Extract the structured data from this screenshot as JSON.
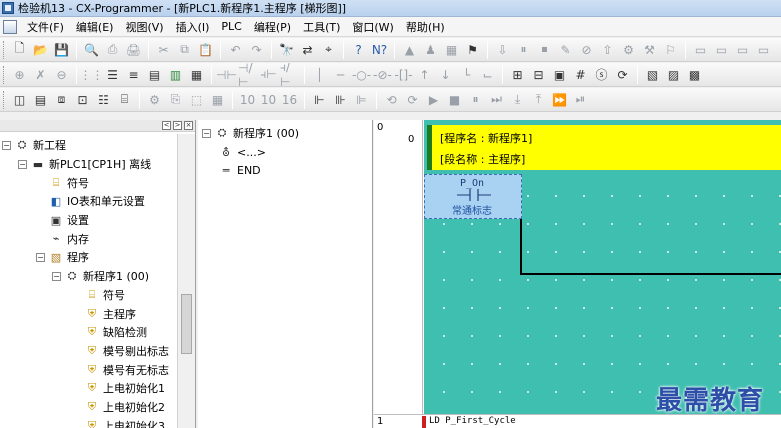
{
  "window": {
    "title": "检验机13 - CX-Programmer - [新PLC1.新程序1.主程序 [梯形图]]"
  },
  "menu": [
    "文件(F)",
    "编辑(E)",
    "视图(V)",
    "插入(I)",
    "PLC",
    "编程(P)",
    "工具(T)",
    "窗口(W)",
    "帮助(H)"
  ],
  "toolbar1": [
    {
      "icon": "new-icon",
      "glyph": "🗋",
      "tone": ""
    },
    {
      "icon": "open-icon",
      "glyph": "📂",
      "tone": ""
    },
    {
      "icon": "save-icon",
      "glyph": "💾",
      "tone": ""
    },
    {
      "icon": "print-preview-icon",
      "glyph": "🔍",
      "tone": ""
    },
    {
      "icon": "print-icon",
      "glyph": "⎙",
      "tone": "dim"
    },
    {
      "icon": "print-setup-icon",
      "glyph": "🖨",
      "tone": "dim"
    },
    {
      "icon": "cut-icon",
      "glyph": "✂",
      "tone": "dim"
    },
    {
      "icon": "copy-icon",
      "glyph": "⧉",
      "tone": "dim"
    },
    {
      "icon": "paste-icon",
      "glyph": "📋",
      "tone": "dim"
    },
    {
      "icon": "undo-icon",
      "glyph": "↶",
      "tone": "dim"
    },
    {
      "icon": "redo-icon",
      "glyph": "↷",
      "tone": "dim"
    },
    {
      "icon": "find-icon",
      "glyph": "🔭",
      "tone": ""
    },
    {
      "icon": "replace-icon",
      "glyph": "⇄",
      "tone": ""
    },
    {
      "icon": "find-address-icon",
      "glyph": "⌖",
      "tone": ""
    },
    {
      "icon": "help-icon",
      "glyph": "?",
      "tone": "blue"
    },
    {
      "icon": "context-help-icon",
      "glyph": "N?",
      "tone": "blue"
    },
    {
      "icon": "online-icon",
      "glyph": "▲",
      "tone": "dim"
    },
    {
      "icon": "monitor-icon",
      "glyph": "♟",
      "tone": "dim"
    },
    {
      "icon": "monitor-data-icon",
      "glyph": "▦",
      "tone": "dim"
    },
    {
      "icon": "compare-icon",
      "glyph": "⚑",
      "tone": ""
    },
    {
      "icon": "transfer-icon",
      "glyph": "⇩",
      "tone": "dim"
    },
    {
      "icon": "pause-icon",
      "glyph": "⏸",
      "tone": "dim"
    },
    {
      "icon": "stop-icon",
      "glyph": "⏹",
      "tone": "dim"
    },
    {
      "icon": "edit-online-icon",
      "glyph": "✎",
      "tone": "dim"
    },
    {
      "icon": "cancel-online-icon",
      "glyph": "⊘",
      "tone": "dim"
    },
    {
      "icon": "transfer-online-icon",
      "glyph": "⇧",
      "tone": "dim"
    },
    {
      "icon": "program-mode-icon",
      "glyph": "⚙",
      "tone": "dim"
    },
    {
      "icon": "debug-mode-icon",
      "glyph": "⚒",
      "tone": "dim"
    },
    {
      "icon": "run-mode-icon",
      "glyph": "⚐",
      "tone": "dim"
    },
    {
      "icon": "window1-icon",
      "glyph": "▭",
      "tone": "dim"
    },
    {
      "icon": "window2-icon",
      "glyph": "▭",
      "tone": "dim"
    },
    {
      "icon": "window3-icon",
      "glyph": "▭",
      "tone": "dim"
    },
    {
      "icon": "window4-icon",
      "glyph": "▭",
      "tone": "dim"
    }
  ],
  "toolbar2": [
    {
      "icon": "zoom-in-icon",
      "glyph": "⊕",
      "tone": "dim"
    },
    {
      "icon": "selection-tool-icon",
      "glyph": "✗",
      "tone": "dim"
    },
    {
      "icon": "zoom-out-icon",
      "glyph": "⊖",
      "tone": "dim"
    },
    {
      "icon": "grid-icon",
      "glyph": "⋮⋮",
      "tone": "dim"
    },
    {
      "icon": "comment-icon",
      "glyph": "☰",
      "tone": ""
    },
    {
      "icon": "list-icon",
      "glyph": "≡",
      "tone": ""
    },
    {
      "icon": "rung-comment-icon",
      "glyph": "▤",
      "tone": ""
    },
    {
      "icon": "bar-icon",
      "glyph": "▥",
      "tone": "green"
    },
    {
      "icon": "monitor-comment-icon",
      "glyph": "▦",
      "tone": ""
    },
    {
      "icon": "contact-no-icon",
      "glyph": "⊣⊢",
      "tone": "dim"
    },
    {
      "icon": "contact-nc-icon",
      "glyph": "⊣/⊢",
      "tone": "dim"
    },
    {
      "icon": "contact-or-icon",
      "glyph": "⫞⊢",
      "tone": "dim"
    },
    {
      "icon": "contact-ornc-icon",
      "glyph": "⫞/⊢",
      "tone": "dim"
    },
    {
      "icon": "vertical-line-icon",
      "glyph": "│",
      "tone": "dim"
    },
    {
      "icon": "horizontal-line-icon",
      "glyph": "─",
      "tone": "dim"
    },
    {
      "icon": "coil-icon",
      "glyph": "-○-",
      "tone": "dim"
    },
    {
      "icon": "coil-nc-icon",
      "glyph": "-⊘-",
      "tone": "dim"
    },
    {
      "icon": "instruction-icon",
      "glyph": "-[]-",
      "tone": "dim"
    },
    {
      "icon": "up-diff-icon",
      "glyph": "↑",
      "tone": "dim"
    },
    {
      "icon": "down-diff-icon",
      "glyph": "↓",
      "tone": "dim"
    },
    {
      "icon": "line-connect-icon",
      "glyph": "└",
      "tone": "dim"
    },
    {
      "icon": "line-delete-icon",
      "glyph": "⌙",
      "tone": "dim"
    },
    {
      "icon": "rung-insert-icon",
      "glyph": "⊞",
      "tone": ""
    },
    {
      "icon": "rung-delete-icon",
      "glyph": "⊟",
      "tone": ""
    },
    {
      "icon": "rung-comment-list-icon",
      "glyph": "▣",
      "tone": ""
    },
    {
      "icon": "address-icon",
      "glyph": "#",
      "tone": ""
    },
    {
      "icon": "symbol-icon",
      "glyph": "ⓢ",
      "tone": ""
    },
    {
      "icon": "cross-ref-icon",
      "glyph": "⟳",
      "tone": ""
    },
    {
      "icon": "window-cascade-icon",
      "glyph": "▧",
      "tone": ""
    },
    {
      "icon": "window-tile-icon",
      "glyph": "▨",
      "tone": ""
    },
    {
      "icon": "properties-icon",
      "glyph": "▩",
      "tone": ""
    }
  ],
  "toolbar3": [
    {
      "icon": "project-workspace-icon",
      "glyph": "◫",
      "tone": ""
    },
    {
      "icon": "output-window-icon",
      "glyph": "▤",
      "tone": ""
    },
    {
      "icon": "watch-window-icon",
      "glyph": "⧈",
      "tone": ""
    },
    {
      "icon": "address-reference-icon",
      "glyph": "⊡",
      "tone": ""
    },
    {
      "icon": "io-table-icon",
      "glyph": "☷",
      "tone": ""
    },
    {
      "icon": "memory-view-icon",
      "glyph": "⌸",
      "tone": ""
    },
    {
      "icon": "compile-icon",
      "glyph": "⚙",
      "tone": "dim"
    },
    {
      "icon": "build-icon",
      "glyph": "⎘",
      "tone": "dim"
    },
    {
      "icon": "local-symbols-icon",
      "glyph": "⬚",
      "tone": "dim"
    },
    {
      "icon": "global-symbols-icon",
      "glyph": "▦",
      "tone": "dim"
    },
    {
      "icon": "display-10-icon",
      "glyph": "10",
      "tone": "dim"
    },
    {
      "icon": "display-10b-icon",
      "glyph": "10",
      "tone": "dim"
    },
    {
      "icon": "display-16-icon",
      "glyph": "16",
      "tone": "dim"
    },
    {
      "icon": "bit-set-icon",
      "glyph": "⊩",
      "tone": ""
    },
    {
      "icon": "bit-reset-icon",
      "glyph": "⊪",
      "tone": ""
    },
    {
      "icon": "force-icon",
      "glyph": "⊫",
      "tone": "dim"
    },
    {
      "icon": "sim-start-icon",
      "glyph": "⟲",
      "tone": "dim"
    },
    {
      "icon": "sim-trace-icon",
      "glyph": "⟳",
      "tone": "dim"
    },
    {
      "icon": "sim-run-icon",
      "glyph": "▶",
      "tone": "dim"
    },
    {
      "icon": "sim-stop-icon",
      "glyph": "■",
      "tone": "dim"
    },
    {
      "icon": "sim-pause-icon",
      "glyph": "⏸",
      "tone": "dim"
    },
    {
      "icon": "sim-step-icon",
      "glyph": "⏭",
      "tone": "dim"
    },
    {
      "icon": "sim-step-in-icon",
      "glyph": "⤓",
      "tone": "dim"
    },
    {
      "icon": "sim-step-out-icon",
      "glyph": "⤒",
      "tone": "dim"
    },
    {
      "icon": "sim-fast-icon",
      "glyph": "⏩",
      "tone": "dim"
    },
    {
      "icon": "sim-end-icon",
      "glyph": "⏯",
      "tone": "dim"
    }
  ],
  "workspace": {
    "tree": [
      {
        "label": "新工程",
        "icon": "project-icon",
        "glyph": "⛭",
        "tone": "ic-dark",
        "indent": 2,
        "expander": "−"
      },
      {
        "label": "新PLC1[CP1H] 离线",
        "icon": "plc-icon",
        "glyph": "▬",
        "tone": "ic-dark",
        "indent": 18,
        "expander": "−"
      },
      {
        "label": "符号",
        "icon": "symbols-icon",
        "glyph": "⌸",
        "tone": "ic-yellow",
        "indent": 48,
        "expander": ""
      },
      {
        "label": "IO表和单元设置",
        "icon": "io-table-icon",
        "glyph": "◧",
        "tone": "ic-blue",
        "indent": 48,
        "expander": ""
      },
      {
        "label": "设置",
        "icon": "settings-icon",
        "glyph": "▣",
        "tone": "ic-dark",
        "indent": 48,
        "expander": ""
      },
      {
        "label": "内存",
        "icon": "memory-icon",
        "glyph": "⌁",
        "tone": "ic-dark",
        "indent": 48,
        "expander": ""
      },
      {
        "label": "程序",
        "icon": "programs-icon",
        "glyph": "▧",
        "tone": "ic-folder",
        "indent": 36,
        "expander": "−"
      },
      {
        "label": "新程序1 (00)",
        "icon": "new-program-icon",
        "glyph": "⛭",
        "tone": "ic-dark",
        "indent": 52,
        "expander": "−"
      },
      {
        "label": "符号",
        "icon": "symbols-icon",
        "glyph": "⌸",
        "tone": "ic-yellow",
        "indent": 84,
        "expander": ""
      },
      {
        "label": "主程序",
        "icon": "section-icon",
        "glyph": "⛨",
        "tone": "ic-yellow",
        "indent": 84,
        "expander": ""
      },
      {
        "label": "缺陷检测",
        "icon": "section-icon",
        "glyph": "⛨",
        "tone": "ic-yellow",
        "indent": 84,
        "expander": ""
      },
      {
        "label": "模号剔出标志",
        "icon": "section-icon",
        "glyph": "⛨",
        "tone": "ic-yellow",
        "indent": 84,
        "expander": ""
      },
      {
        "label": "模号有无标志",
        "icon": "section-icon",
        "glyph": "⛨",
        "tone": "ic-yellow",
        "indent": 84,
        "expander": ""
      },
      {
        "label": "上电初始化1",
        "icon": "section-icon",
        "glyph": "⛨",
        "tone": "ic-yellow",
        "indent": 84,
        "expander": ""
      },
      {
        "label": "上电初始化2",
        "icon": "section-icon",
        "glyph": "⛨",
        "tone": "ic-yellow",
        "indent": 84,
        "expander": ""
      },
      {
        "label": "上电初始化3",
        "icon": "section-icon",
        "glyph": "⛨",
        "tone": "ic-yellow",
        "indent": 84,
        "expander": ""
      }
    ],
    "controls": [
      "<",
      ">",
      "×"
    ]
  },
  "sections_tree": [
    {
      "label": "新程序1 (00)",
      "icon": "program-icon",
      "glyph": "⛭",
      "tone": "ic-dark",
      "indent": 4,
      "expander": "−"
    },
    {
      "label": "<...>",
      "icon": "section-list-icon",
      "glyph": "⛢",
      "tone": "ic-dark",
      "indent": 20,
      "expander": ""
    },
    {
      "label": "END",
      "icon": "end-section-icon",
      "glyph": "═",
      "tone": "ic-dark",
      "indent": 20,
      "expander": ""
    }
  ],
  "ladder": {
    "rung0": {
      "index": "0",
      "step": "0",
      "program_name": "[程序名 : 新程序1]",
      "section_name": "[段名称 : 主程序]",
      "contact_operand": "P_On",
      "contact_comment": "常通标志"
    },
    "rung1": {
      "index": "1",
      "mnemonic": "LD P_First_Cycle"
    }
  },
  "watermark": "最需教育",
  "colors": {
    "canvas": "#3fbfb0",
    "header": "#ffff00",
    "selection": "#a9d1f2",
    "rung_bar_active": "#1f7a1f",
    "rung_bar_error": "#cc1f1f"
  }
}
